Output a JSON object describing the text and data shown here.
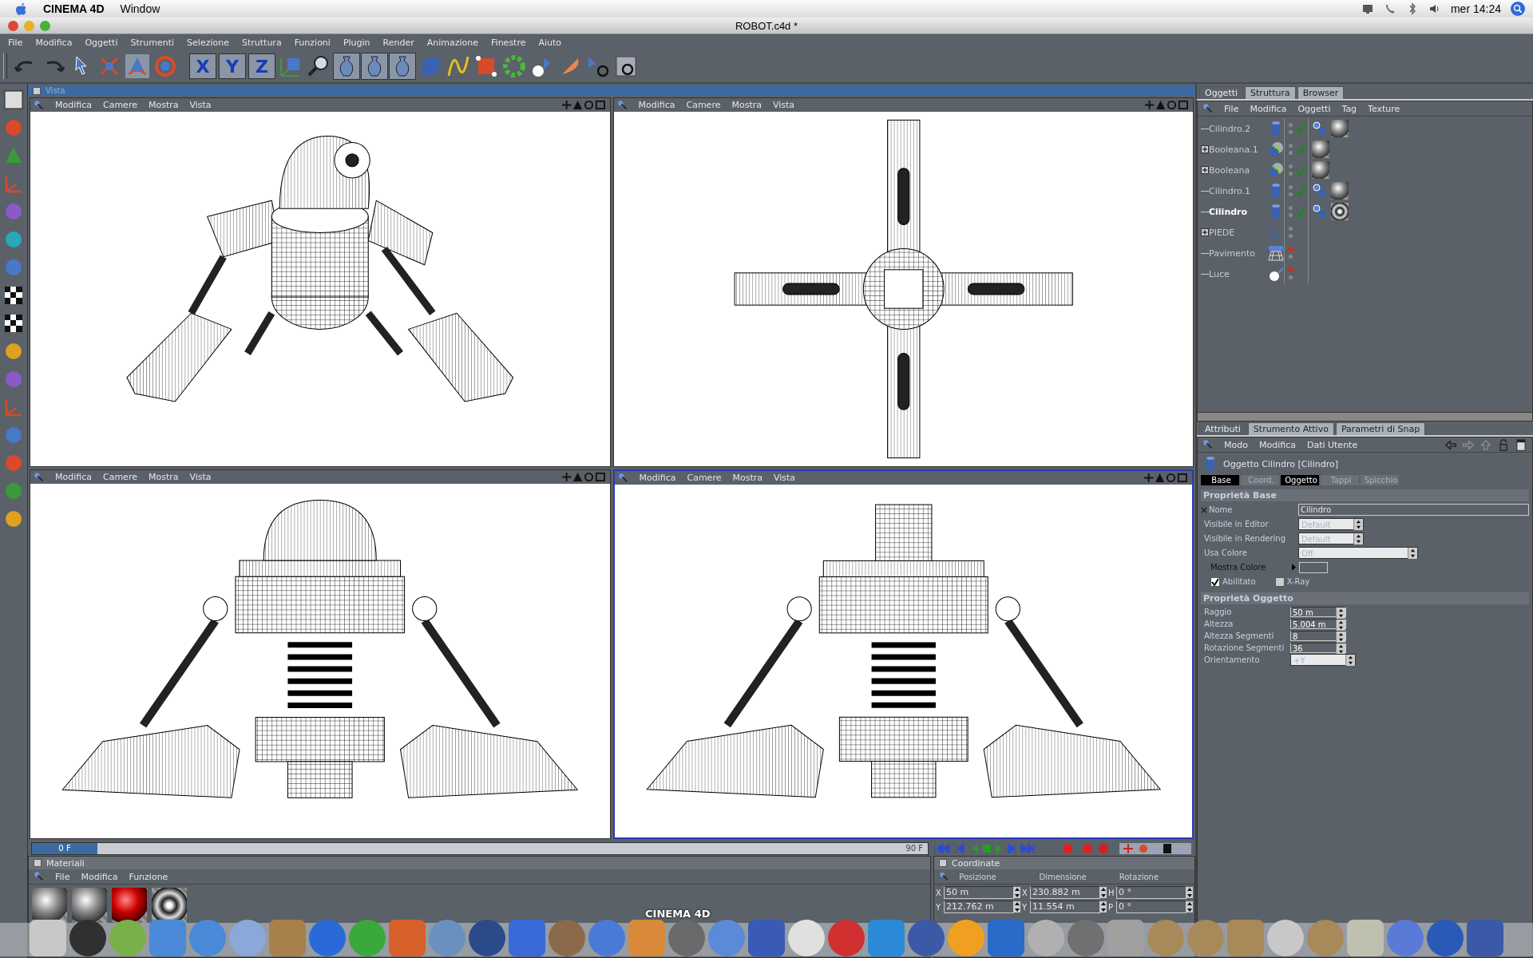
{
  "mac_menubar": {
    "app": "CINEMA 4D",
    "items": [
      "Window"
    ],
    "clock": "mer 14:24"
  },
  "window": {
    "title": "ROBOT.c4d *"
  },
  "menu": [
    "File",
    "Modifica",
    "Oggetti",
    "Strumenti",
    "Selezione",
    "Struttura",
    "Funzioni",
    "Plugin",
    "Render",
    "Animazione",
    "Finestre",
    "Aiuto"
  ],
  "axis_buttons": [
    {
      "label": "X",
      "on": true
    },
    {
      "label": "Y",
      "on": true
    },
    {
      "label": "Z",
      "on": true
    }
  ],
  "view_panel": {
    "title": "Vista"
  },
  "viewports": [
    {
      "kind": "perspective",
      "menu": [
        "Modifica",
        "Camere",
        "Mostra",
        "Vista"
      ],
      "selected": false
    },
    {
      "kind": "top",
      "menu": [
        "Modifica",
        "Camere",
        "Mostra",
        "Vista"
      ],
      "selected": false
    },
    {
      "kind": "front",
      "menu": [
        "Modifica",
        "Camere",
        "Mostra",
        "Vista"
      ],
      "selected": false
    },
    {
      "kind": "side",
      "menu": [
        "Modifica",
        "Camere",
        "Mostra",
        "Vista"
      ],
      "selected": true
    }
  ],
  "timeline": {
    "current": "0 F",
    "end": "90 F",
    "level": 0
  },
  "materials": {
    "title": "Materiali",
    "menu": [
      "File",
      "Modifica",
      "Funzione"
    ],
    "swatches": [
      {
        "kind": "metal"
      },
      {
        "kind": "metal"
      },
      {
        "kind": "red"
      },
      {
        "kind": "chrome"
      }
    ]
  },
  "coordinates": {
    "title": "Coordinate",
    "columns": [
      "Posizione",
      "Dimensione",
      "Rotazione"
    ],
    "rows": [
      [
        {
          "axis": "X",
          "value": "50 m"
        },
        {
          "axis": "X",
          "value": "230.882 m"
        },
        {
          "axis": "H",
          "value": "0 °"
        }
      ],
      [
        {
          "axis": "Y",
          "value": "212.762 m"
        },
        {
          "axis": "Y",
          "value": "11.554 m"
        },
        {
          "axis": "P",
          "value": "0 °"
        }
      ]
    ]
  },
  "dock": {
    "tooltip": "CINEMA 4D"
  },
  "object_manager": {
    "tabs": [
      {
        "label": "Oggetti",
        "selected": true
      },
      {
        "label": "Struttura",
        "selected": false
      },
      {
        "label": "Browser",
        "selected": false
      }
    ],
    "menu": [
      "File",
      "Modifica",
      "Oggetti",
      "Tag",
      "Texture"
    ],
    "objects": [
      {
        "name": "Cilindro.2",
        "kind": "cylinder",
        "expandable": false,
        "selected": false,
        "editor_off": false,
        "checked": true,
        "tags": [
          {
            "kind": "link"
          },
          {
            "kind": "material"
          }
        ]
      },
      {
        "name": "Booleana.1",
        "kind": "boolean",
        "expandable": true,
        "selected": false,
        "editor_off": false,
        "checked": true,
        "tags": [
          {
            "kind": "material"
          }
        ]
      },
      {
        "name": "Booleana",
        "kind": "boolean",
        "expandable": true,
        "selected": false,
        "editor_off": false,
        "checked": true,
        "tags": [
          {
            "kind": "material"
          }
        ]
      },
      {
        "name": "Cilindro.1",
        "kind": "cylinder",
        "expandable": false,
        "selected": false,
        "editor_off": false,
        "checked": true,
        "tags": [
          {
            "kind": "link"
          },
          {
            "kind": "material"
          }
        ]
      },
      {
        "name": "Cilindro",
        "kind": "cylinder",
        "expandable": false,
        "selected": true,
        "editor_off": false,
        "checked": true,
        "tags": [
          {
            "kind": "link"
          },
          {
            "kind": "chrome"
          }
        ]
      },
      {
        "name": "PIEDE",
        "kind": "null",
        "expandable": true,
        "selected": false,
        "editor_off": false,
        "checked": false
      },
      {
        "name": "Pavimento",
        "kind": "floor",
        "expandable": false,
        "selected": false,
        "editor_off": true,
        "checked": false
      },
      {
        "name": "Luce",
        "kind": "light",
        "expandable": false,
        "selected": false,
        "editor_off": true,
        "checked": false
      }
    ]
  },
  "attributes": {
    "tabs": [
      {
        "label": "Attributi",
        "selected": true
      },
      {
        "label": "Strumento Attivo",
        "selected": false
      },
      {
        "label": "Parametri di Snap",
        "selected": false
      }
    ],
    "menu": [
      "Modo",
      "Modifica",
      "Dati Utente"
    ],
    "header": "Oggetto Cilindro [Cilindro]",
    "subtabs": [
      {
        "label": "Base",
        "selected": true
      },
      {
        "label": "Coord.",
        "selected": false
      },
      {
        "label": "Oggetto",
        "selected": true
      },
      {
        "label": "Tappi",
        "selected": false
      },
      {
        "label": "Spicchio",
        "selected": false
      }
    ],
    "sections": [
      {
        "title": "Proprietà Base",
        "fields": [
          {
            "kind": "text",
            "label": "Nome",
            "value": "Cilindro"
          },
          {
            "kind": "dropdown",
            "label": "Visibile in Editor",
            "value": "Default",
            "disabled": true
          },
          {
            "kind": "dropdown",
            "label": "Visibile in Rendering",
            "value": "Default",
            "disabled": true
          },
          {
            "kind": "wide-dropdown",
            "label": "Usa Colore",
            "value": "Off",
            "disabled": true
          },
          {
            "kind": "color",
            "label": "Mostra Colore"
          },
          {
            "kind": "checks",
            "items": [
              {
                "label": "Abilitato",
                "checked": true
              },
              {
                "label": "X-Ray",
                "checked": false
              }
            ]
          }
        ]
      },
      {
        "title": "Proprietà Oggetto",
        "fields": [
          {
            "kind": "number",
            "label": "Raggio",
            "value": "50 m"
          },
          {
            "kind": "number",
            "label": "Altezza",
            "value": "5.004 m"
          },
          {
            "kind": "number",
            "label": "Altezza Segmenti",
            "value": "8"
          },
          {
            "kind": "number",
            "label": "Rotazione Segmenti",
            "value": "36"
          },
          {
            "kind": "dropdown",
            "label": "Orientamento",
            "value": "+Y",
            "disabled": true
          }
        ]
      }
    ]
  }
}
